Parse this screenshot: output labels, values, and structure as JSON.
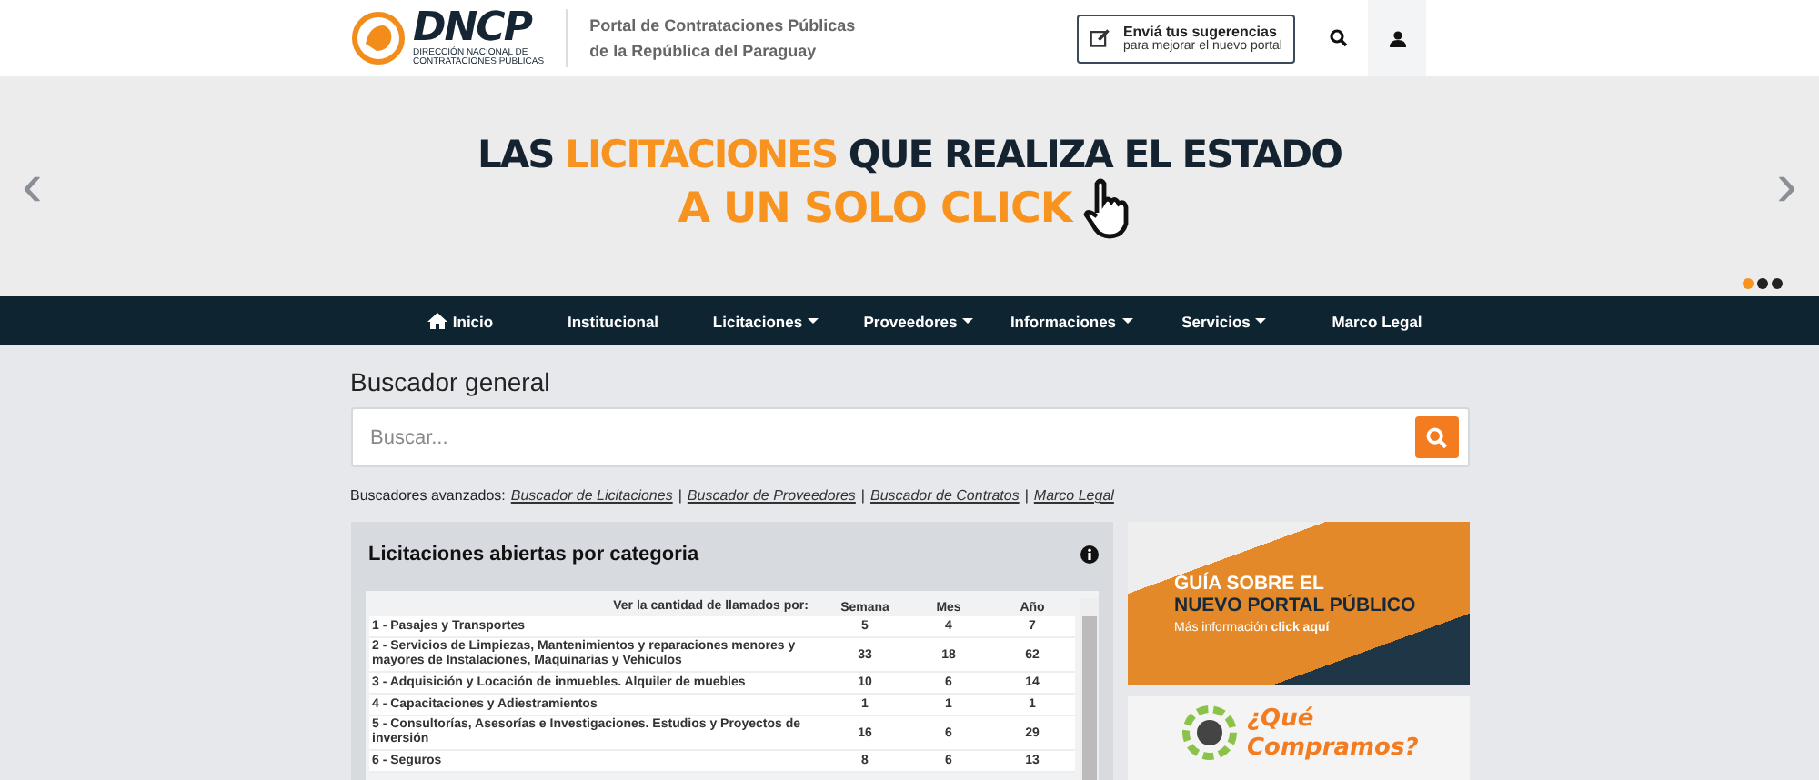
{
  "header": {
    "logo_text": "DNCP",
    "logo_subtitle": [
      "DIRECCIÓN NACIONAL DE",
      "CONTRATACIONES PÚBLICAS"
    ],
    "portal_title": [
      "Portal de Contrataciones Públicas",
      "de la República del Paraguay"
    ],
    "feedback": {
      "title": "Enviá tus sugerencias",
      "subtitle": "para mejorar el nuevo portal"
    }
  },
  "banner": {
    "line1": [
      {
        "text": "LAS ",
        "accent": false
      },
      {
        "text": "LICITACIONES",
        "accent": true
      },
      {
        "text": " QUE REALIZA EL ESTADO",
        "accent": false
      }
    ],
    "line2": "A UN SOLO CLICK",
    "prev": "‹",
    "next": "›",
    "dots": [
      {
        "selected": true
      },
      {
        "selected": false
      },
      {
        "selected": false
      }
    ]
  },
  "nav": [
    {
      "label": "Inicio",
      "kind": "home"
    },
    {
      "label": "Institucional",
      "kind": "plain"
    },
    {
      "label": "Licitaciones",
      "kind": "dropdown"
    },
    {
      "label": "Proveedores",
      "kind": "dropdown"
    },
    {
      "label": "Informaciones",
      "kind": "dropdown"
    },
    {
      "label": "Servicios",
      "kind": "dropdown"
    },
    {
      "label": "Marco Legal",
      "kind": "plain"
    }
  ],
  "search": {
    "title": "Buscador general",
    "placeholder": "Buscar...",
    "advanced_label": "Buscadores avanzados:",
    "advanced_links": [
      "Buscador de Licitaciones",
      "Buscador de Proveedores",
      "Buscador de Contratos",
      "Marco Legal"
    ],
    "separator": "|"
  },
  "panel": {
    "title": "Licitaciones abiertas por categoria",
    "table": {
      "columns": [
        "Ver la cantidad de llamados por:",
        "Semana",
        "Mes",
        "Año"
      ],
      "rows": [
        [
          "1 - Pasajes y Transportes",
          "5",
          "4",
          "7"
        ],
        [
          "2 - Servicios de Limpiezas, Mantenimientos y reparaciones menores y mayores de Instalaciones, Maquinarias y Vehiculos",
          "33",
          "18",
          "62"
        ],
        [
          "3 - Adquisición y Locación de inmuebles. Alquiler de muebles",
          "10",
          "6",
          "14"
        ],
        [
          "4 - Capacitaciones y Adiestramientos",
          "1",
          "1",
          "1"
        ],
        [
          "5 - Consultorías, Asesorías e Investigaciones. Estudios y Proyectos de inversión",
          "16",
          "6",
          "29"
        ],
        [
          "6 - Seguros",
          "8",
          "6",
          "13"
        ]
      ]
    }
  },
  "promo": {
    "title_lines": [
      "GUÍA SOBRE EL",
      "NUEVO PORTAL PÚBLICO"
    ],
    "more": "Más información **click aquí**"
  },
  "promo2": {
    "text": "¿Qué Compramos?"
  }
}
